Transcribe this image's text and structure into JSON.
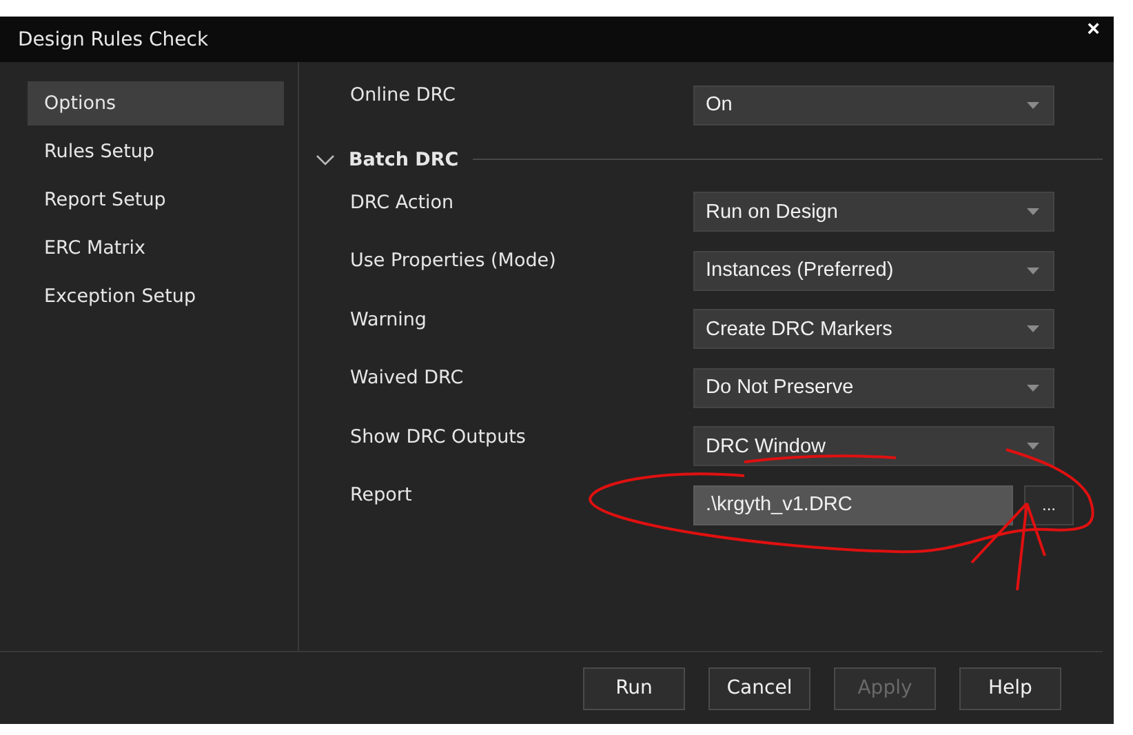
{
  "window": {
    "title": "Design Rules Check",
    "close": "×"
  },
  "sidebar": {
    "items": [
      {
        "label": "Options",
        "selected": true
      },
      {
        "label": "Rules Setup",
        "selected": false
      },
      {
        "label": "Report Setup",
        "selected": false
      },
      {
        "label": "ERC Matrix",
        "selected": false
      },
      {
        "label": "Exception Setup",
        "selected": false
      }
    ]
  },
  "options": [
    {
      "kind": "dropdown",
      "label": "Online DRC",
      "value": "On"
    }
  ],
  "batch_drc": {
    "title": "Batch DRC",
    "expanded": true,
    "rows": [
      {
        "kind": "dropdown",
        "label": "DRC Action",
        "value": "Run on Design"
      },
      {
        "kind": "dropdown",
        "label": "Use Properties (Mode)",
        "value": "Instances (Preferred)"
      },
      {
        "kind": "dropdown",
        "label": "Warning",
        "value": "Create DRC Markers"
      },
      {
        "kind": "dropdown",
        "label": "Waived DRC",
        "value": "Do Not Preserve"
      },
      {
        "kind": "dropdown",
        "label": "Show DRC Outputs",
        "value": "DRC Window"
      },
      {
        "kind": "file",
        "label": "Report",
        "value": ".\\krgyth_v1.DRC",
        "browse": "..."
      }
    ]
  },
  "buttons": [
    {
      "label": "Run",
      "disabled": false
    },
    {
      "label": "Cancel",
      "disabled": false
    },
    {
      "label": "Apply",
      "disabled": true
    },
    {
      "label": "Help",
      "disabled": false
    }
  ]
}
